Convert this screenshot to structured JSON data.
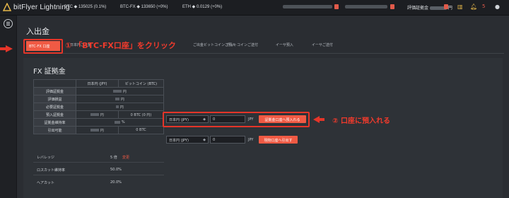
{
  "topbar": {
    "logo_text": "bitFlyer Lightning",
    "btc_ticker": "BTC ◆ 135025 (0.1%)",
    "btcfx_ticker": "BTC-FX ◆ 133650 (+0%)",
    "eth_ticker": "ETH ◆ 0.0129 (+0%)",
    "eval_label": "評価証拠金",
    "eval_unit": "円",
    "notif_count": "5"
  },
  "page": {
    "title": "入出金"
  },
  "tabs": [
    {
      "label": "BTC-FX 口座"
    },
    {
      "label": "日本円ご入金"
    },
    {
      "label": "ご出金"
    },
    {
      "label": "ビットコインご預入"
    },
    {
      "label": "ビットコインご送付"
    },
    {
      "label": "イーサ預入"
    },
    {
      "label": "イーサご送付"
    }
  ],
  "annotations": {
    "step1": "① 「BTC-FX口座」をクリック",
    "step2": "② 口座に預入れる"
  },
  "section": {
    "title": "FX 証拠金"
  },
  "table": {
    "headers": [
      "",
      "日本円 (JPY)",
      "ビットコイン (BTC)"
    ],
    "rows": [
      {
        "label": "評価証拠金",
        "jpy_unit": "円",
        "btc_unit": ""
      },
      {
        "label": "評価損益",
        "jpy_unit": "円",
        "btc_unit": ""
      },
      {
        "label": "必要証拠金",
        "jpy_unit": "円",
        "btc_unit": ""
      },
      {
        "label": "預入証拠金",
        "jpy_unit": "円",
        "btc_unit": "0 BTC (0 円)"
      },
      {
        "label": "証拠金維持率",
        "jpy_unit": "%",
        "btc_unit": ""
      },
      {
        "label": "引出可能",
        "jpy_unit": "円",
        "btc_unit": "0 BTC"
      }
    ]
  },
  "deposit_form": {
    "currency": "日本円 (JPY)",
    "amount": "0",
    "unit": "JPY",
    "button": "証拠金口座へ預入れる"
  },
  "withdraw_form": {
    "currency": "日本円 (JPY)",
    "amount": "0",
    "unit": "JPY",
    "button": "現物口座へ引出す"
  },
  "leverage": {
    "label": "レバレッジ",
    "value": "5 倍",
    "change": "変更"
  },
  "losscut": {
    "label": "ロスカット維持率",
    "value": "50.0%"
  },
  "haircut": {
    "label": "ヘアカット",
    "value": "20.0%"
  }
}
